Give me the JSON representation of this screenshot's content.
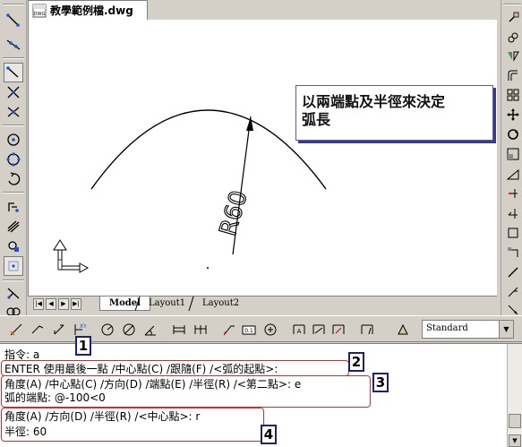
{
  "document": {
    "tab_title": "教學範例檔.dwg",
    "tab_icon": "dwg-file-icon",
    "icon_label": "DWG"
  },
  "drawing": {
    "dimension_text": "R60"
  },
  "callout": {
    "line1": "以兩端點及半徑來決定",
    "line2": "弧長"
  },
  "layout_tabs": [
    {
      "label": "Model",
      "active": true
    },
    {
      "label": "Layout1",
      "active": false
    },
    {
      "label": "Layout2",
      "active": false
    }
  ],
  "nav_buttons": [
    "first-icon",
    "prev-icon",
    "next-icon",
    "last-icon"
  ],
  "left_toolbar": [
    "line-icon",
    "xline-icon",
    "polyline-icon",
    "polygon-icon",
    "rectangle-icon",
    "arc-icon",
    "circle-icon",
    "cloud-icon",
    "spline-icon",
    "ellipse-icon",
    "ellipse-arc-icon",
    "insert-block-icon",
    "make-block-icon",
    "point-icon"
  ],
  "right_toolbar": [
    "erase-icon",
    "copy-icon",
    "mirror-icon",
    "offset-icon",
    "array-icon",
    "move-icon",
    "rotate-icon",
    "scale-icon",
    "stretch-icon",
    "trim-icon",
    "extend-icon",
    "break-icon",
    "join-icon",
    "chamfer-icon",
    "fillet-icon",
    "explode-icon"
  ],
  "dim_toolbar": [
    "linear-dim-icon",
    "aligned-dim-icon",
    "arc-length-icon",
    "ordinate-dim-icon",
    "radius-dim-icon",
    "jogged-dim-icon",
    "diameter-dim-icon",
    "angular-dim-icon",
    "quick-dim-icon",
    "baseline-dim-icon",
    "continue-dim-icon",
    "quick-leader-icon",
    "tolerance-icon",
    "center-mark-icon",
    "dim-edit-icon",
    "dim-text-edit-icon",
    "dim-update-icon",
    "dim-style-icon"
  ],
  "dim_style": {
    "value": "Standard"
  },
  "command": {
    "lines": [
      "指令: a",
      "ENTER 使用最後一點 /中心點(C) /跟隨(F) /<弧的起點>:",
      "角度(A) /中心點(C) /方向(D) /端點(E) /半徑(R) /<第二點>: e",
      "弧的端點: @-100<0",
      "角度(A) /方向(D) /半徑(R) /<中心點>: r",
      "半徑: 60"
    ]
  },
  "annotations": [
    "1",
    "2",
    "3",
    "4"
  ],
  "colors": {
    "toolbar": "#d4d0c8",
    "canvas": "#ffffff",
    "annotation_box": "#c83030",
    "badge_border": "#202070",
    "callout_shadow": "#3a3a8a"
  }
}
